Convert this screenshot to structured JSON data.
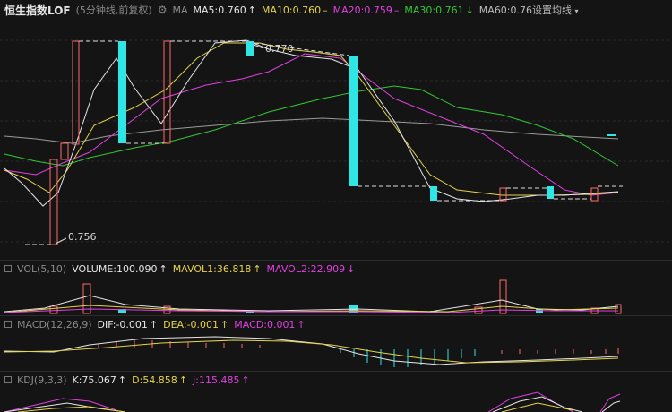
{
  "header": {
    "title": "恒生指数LOF",
    "subtitle": "(5分钟线,前复权)",
    "ma_label": "MA",
    "ma5": "MA5:0.760",
    "ma5_arrow": "↑",
    "ma10": "MA10:0.760",
    "ma10_arrow": "–",
    "ma20": "MA20:0.759",
    "ma20_arrow": "–",
    "ma30": "MA30:0.761",
    "ma30_arrow": "↓",
    "ma60": "MA60:0.76",
    "settings": "设置均线",
    "colors": {
      "ma5": "#e6e6e6",
      "ma10": "#e5d34a",
      "ma20": "#e040e0",
      "ma30": "#34c734",
      "ma60": "#bbbbbb"
    }
  },
  "main_chart": {
    "high_label": "0.770",
    "low_label": "0.756",
    "up_color": "#ff6a6a",
    "down_color": "#2ee6e6"
  },
  "vol": {
    "label": "VOL(5,10)",
    "volume": "VOLUME:100.090",
    "volume_arrow": "↑",
    "mavol1": "MAVOL1:36.818",
    "mavol1_arrow": "↑",
    "mavol2": "MAVOL2:22.909",
    "mavol2_arrow": "↓"
  },
  "macd": {
    "label": "MACD(12,26,9)",
    "dif": "DIF:-0.001",
    "dif_arrow": "↑",
    "dea": "DEA:-0.001",
    "dea_arrow": "↑",
    "macd": "MACD:0.001",
    "macd_arrow": "↑"
  },
  "kdj": {
    "label": "KDJ(9,3,3)",
    "k": "K:75.067",
    "k_arrow": "↑",
    "d": "D:54.858",
    "d_arrow": "↑",
    "j": "J:115.485",
    "j_arrow": "↑"
  }
}
